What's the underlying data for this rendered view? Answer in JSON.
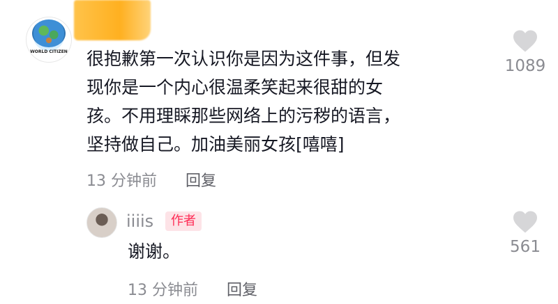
{
  "comments": [
    {
      "text_lines": [
        "很抱歉第一次认识你是因为这件事，但发",
        "现你是一个内心很温柔笑起来很甜的女",
        "孩。不用理睬那些网络上的污秽的语言，",
        "坚持做自己。加油美丽女孩[嘻嘻]"
      ],
      "time": "13 分钟前",
      "reply_label": "回复",
      "like_count": "1089",
      "avatar_text": "WORLD CITIZEN"
    },
    {
      "username": "iiiis",
      "badge": "作者",
      "text": "谢谢。",
      "time": "13 分钟前",
      "reply_label": "回复",
      "like_count": "561"
    }
  ],
  "icons": {
    "like": "heart-icon"
  },
  "colors": {
    "accent": "#fe2c55",
    "muted": "#8a8b91"
  }
}
